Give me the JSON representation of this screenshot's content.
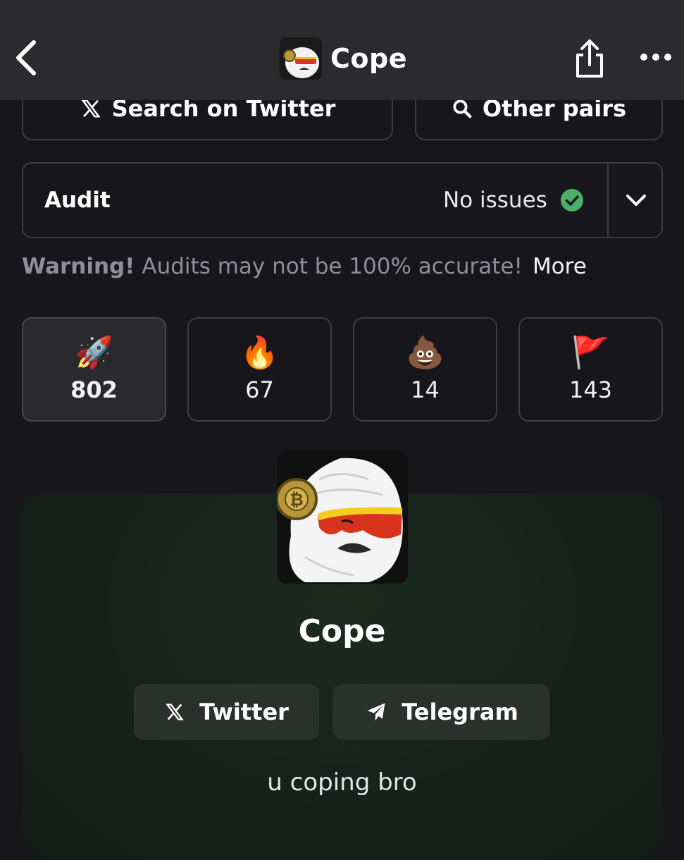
{
  "header": {
    "title": "Cope",
    "icons": {
      "back": "chevron-left-icon",
      "share": "share-icon",
      "more": "more-horizontal-icon"
    }
  },
  "actions": {
    "search_twitter": "Search on Twitter",
    "other_pairs": "Other pairs"
  },
  "audit": {
    "label": "Audit",
    "status": "No issues",
    "status_color": "#4caf6a"
  },
  "warning": {
    "strong": "Warning!",
    "text": "Audits may not be 100% accurate!",
    "more": "More"
  },
  "reactions": [
    {
      "emoji": "🚀",
      "count": "802",
      "icon": "rocket-icon"
    },
    {
      "emoji": "🔥",
      "count": "67",
      "icon": "fire-icon"
    },
    {
      "emoji": "💩",
      "count": "14",
      "icon": "poop-icon"
    },
    {
      "emoji": "🚩",
      "count": "143",
      "icon": "red-flag-icon"
    }
  ],
  "token": {
    "name": "Cope",
    "description": "u coping bro",
    "links": {
      "twitter": "Twitter",
      "telegram": "Telegram"
    }
  },
  "colors": {
    "background": "#17171b",
    "header": "#2b2b2f",
    "card": "#15201a",
    "border": "#3c3c41"
  }
}
